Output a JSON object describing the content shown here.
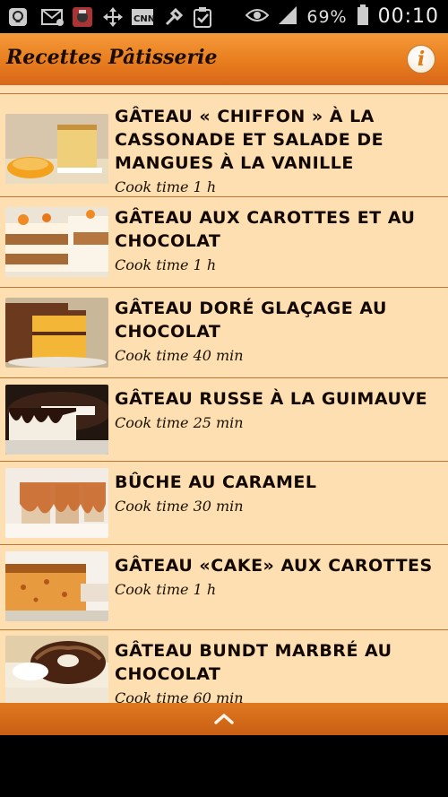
{
  "status_bar": {
    "signal_percent": "69%",
    "time": "00:10",
    "icons": [
      "bbm-icon",
      "email-icon",
      "app-icon",
      "move-icon",
      "cnn-icon",
      "tools-icon",
      "clipboard-check-icon",
      "eye-icon",
      "signal-icon",
      "battery-icon"
    ]
  },
  "app_bar": {
    "title": "Recettes Pâtisserie",
    "info_label": "i"
  },
  "recipes": [
    {
      "title": "GÂTEAU « CHIFFON » À LA CASSONADE ET SALADE DE MANGUES À LA VANILLE",
      "cook_time": "Cook time 1 h"
    },
    {
      "title": "GÂTEAU AUX CAROTTES ET AU CHOCOLAT",
      "cook_time": "Cook time 1 h"
    },
    {
      "title": "GÂTEAU DORÉ GLAÇAGE AU CHOCOLAT",
      "cook_time": "Cook time 40 min"
    },
    {
      "title": "GÂTEAU RUSSE À LA GUIMAUVE",
      "cook_time": "Cook time 25 min"
    },
    {
      "title": "BÛCHE AU CARAMEL",
      "cook_time": "Cook time 30 min"
    },
    {
      "title": "GÂTEAU «CAKE» AUX CAROTTES",
      "cook_time": "Cook time 1 h"
    },
    {
      "title": "GÂTEAU BUNDT MARBRÉ AU CHOCOLAT",
      "cook_time": "Cook time 60 min"
    }
  ],
  "colors": {
    "app_bar": "#e87d1e",
    "list_bg": "#fddfb1",
    "divider": "#c27431"
  }
}
